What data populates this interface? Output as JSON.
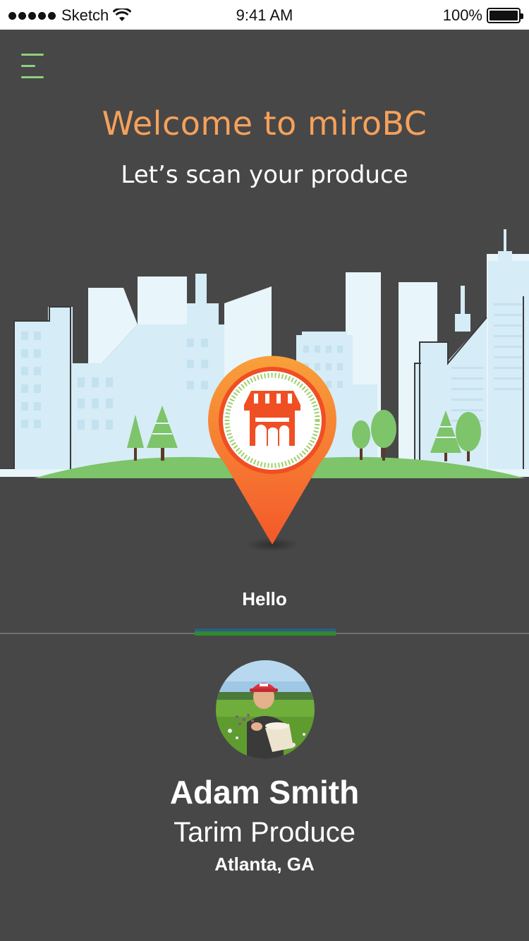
{
  "status_bar": {
    "carrier": "Sketch",
    "time": "9:41 AM",
    "battery": "100%"
  },
  "header": {
    "menu_icon": "hamburger-menu-icon",
    "title": "Welcome to miroBC",
    "subtitle": "Let’s scan your produce"
  },
  "illustration": {
    "pin_icon": "store-location-pin-icon"
  },
  "tabs": {
    "active_label": "Hello"
  },
  "profile": {
    "name": "Adam Smith",
    "company": "Tarim Produce",
    "location": "Atlanta, GA"
  },
  "colors": {
    "background": "#474747",
    "title_accent": "#f6a15a",
    "menu_accent": "#8fd07b",
    "pin_orange": "#f26a2a",
    "grass": "#7dc46a",
    "building": "#d6ecf6"
  }
}
